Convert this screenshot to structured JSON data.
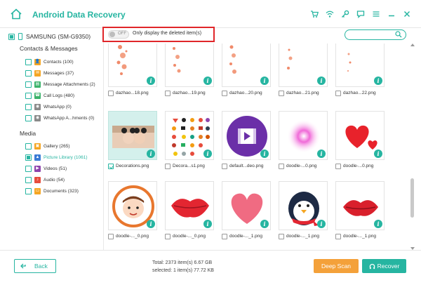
{
  "app": {
    "title": "Android Data Recovery"
  },
  "titlebar": {
    "icons": [
      "cart-icon",
      "wifi-icon",
      "key-icon",
      "chat-icon",
      "menu-icon",
      "minimize-icon",
      "close-icon"
    ]
  },
  "device": {
    "name": "SAMSUNG (SM-G9350)"
  },
  "sidebar": {
    "sections": [
      {
        "title": "Contacts & Messages",
        "items": [
          {
            "label": "Contacts (100)",
            "icon": "contacts-icon",
            "color": "#f5a623"
          },
          {
            "label": "Messages (37)",
            "icon": "messages-icon",
            "color": "#f5a623"
          },
          {
            "label": "Message Attachments (2)",
            "icon": "attachments-icon",
            "color": "#3bb36b"
          },
          {
            "label": "Call Logs (480)",
            "icon": "call-logs-icon",
            "color": "#3bb36b"
          },
          {
            "label": "WhatsApp (0)",
            "icon": "whatsapp-icon",
            "color": "#8a8a8a"
          },
          {
            "label": "WhatsApp A...hments (0)",
            "icon": "whatsapp-attachments-icon",
            "color": "#8a8a8a"
          }
        ]
      },
      {
        "title": "Media",
        "items": [
          {
            "label": "Gallery (265)",
            "icon": "gallery-icon",
            "color": "#f5a623"
          },
          {
            "label": "Picture Library (1061)",
            "icon": "picture-library-icon",
            "color": "#3a7bd5"
          },
          {
            "label": "Videos (51)",
            "icon": "videos-icon",
            "color": "#8e44ad"
          },
          {
            "label": "Audio (54)",
            "icon": "audio-icon",
            "color": "#e74c3c"
          },
          {
            "label": "Documents (323)",
            "icon": "documents-icon",
            "color": "#f5a623"
          }
        ]
      }
    ]
  },
  "toolbar": {
    "toggle_state": "OFF",
    "only_deleted_label": "Only display the deleted item(s)",
    "search_placeholder": ""
  },
  "grid": {
    "rows": [
      [
        {
          "name": "dazhao...18.png",
          "thumb": "splatter"
        },
        {
          "name": "dazhao...19.png",
          "thumb": "splatter"
        },
        {
          "name": "dazhao...20.png",
          "thumb": "splatter"
        },
        {
          "name": "dazhao...21.png",
          "thumb": "splatter"
        },
        {
          "name": "dazhao...22.png",
          "thumb": "splatter"
        }
      ],
      [
        {
          "name": "Decorations.png",
          "thumb": "photo",
          "checked": true
        },
        {
          "name": "Decora...s1.png",
          "thumb": "stickers"
        },
        {
          "name": "default...deo.png",
          "thumb": "video-play"
        },
        {
          "name": "doodle-...0.png",
          "thumb": "glow"
        },
        {
          "name": "doodle-...0.png",
          "thumb": "hearts"
        }
      ],
      [
        {
          "name": "doodle-..._0.png",
          "thumb": "face"
        },
        {
          "name": "doodle-..._0.png",
          "thumb": "lips"
        },
        {
          "name": "doodle-..._1.png",
          "thumb": "heart"
        },
        {
          "name": "doodle-..._1.png",
          "thumb": "penguin"
        },
        {
          "name": "doodle-..._1.png",
          "thumb": "lips"
        }
      ]
    ]
  },
  "footer": {
    "back_label": "Back",
    "total_text": "Total: 2373 item(s) 6.67 GB",
    "selected_text": "selected: 1 item(s) 77.72 KB",
    "deep_scan_label": "Deep Scan",
    "recover_label": "Recover"
  },
  "colors": {
    "accent": "#26b5a1",
    "orange": "#f4a13a",
    "highlight_red": "#e0262a"
  }
}
